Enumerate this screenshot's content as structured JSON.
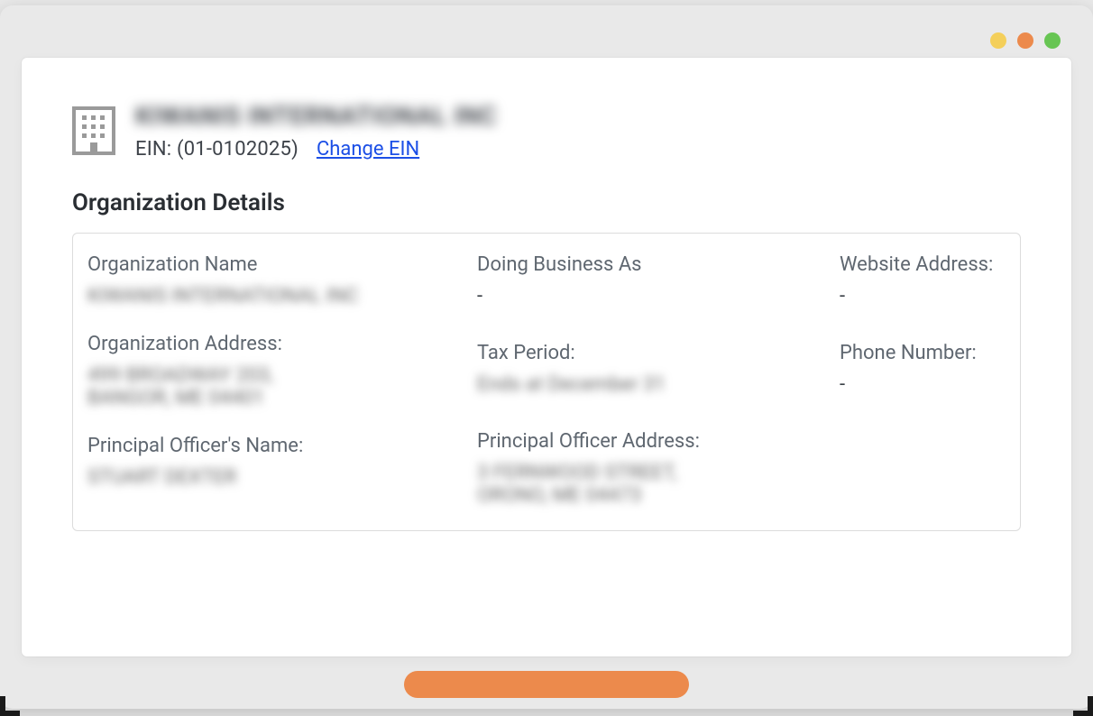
{
  "window": {
    "dots": [
      "yellow",
      "orange",
      "green"
    ]
  },
  "header": {
    "org_name_blurred": "KIWANIS INTERNATIONAL INC",
    "ein_label": "EIN:",
    "ein_value": "(01-0102025)",
    "change_ein_label": "Change EIN"
  },
  "section_title": "Organization Details",
  "details": {
    "col_a": [
      {
        "label": "Organization Name",
        "value": "KIWANIS INTERNATIONAL INC",
        "blurred": true
      },
      {
        "label": "Organization Address:",
        "value": "499 BROADWAY 203,\nBANGOR, ME 04401",
        "blurred": true
      },
      {
        "label": "Principal Officer's Name:",
        "value": "STUART DEXTER",
        "blurred": true
      }
    ],
    "col_b": [
      {
        "label": "Doing Business As",
        "value": "-",
        "blurred": false
      },
      {
        "label": "Tax Period:",
        "value": "Ends at December 31",
        "blurred": true
      },
      {
        "label": "Principal Officer Address:",
        "value": "3 FERNWOOD STREET,\nORONO, ME 04473",
        "blurred": true
      }
    ],
    "col_c": [
      {
        "label": "Website Address:",
        "value": "-",
        "blurred": false
      },
      {
        "label": "Phone Number:",
        "value": "-",
        "blurred": false
      }
    ]
  }
}
